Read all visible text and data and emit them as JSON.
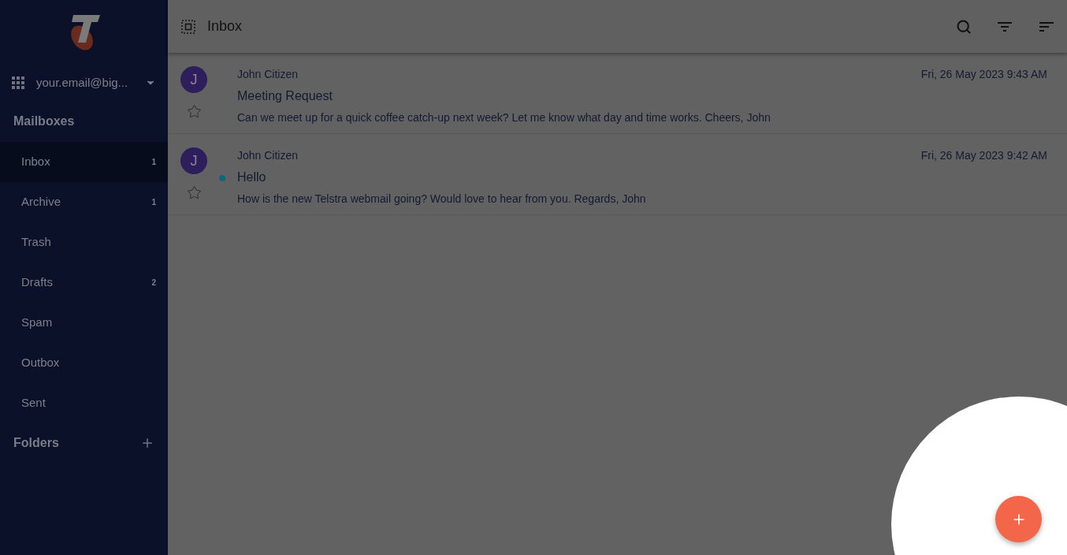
{
  "sidebar": {
    "account": "your.email@big...",
    "mailboxes_heading": "Mailboxes",
    "mailboxes": [
      {
        "label": "Inbox",
        "count": "1",
        "selected": true
      },
      {
        "label": "Archive",
        "count": "1",
        "selected": false
      },
      {
        "label": "Trash",
        "selected": false
      },
      {
        "label": "Drafts",
        "count": "2",
        "selected": false
      },
      {
        "label": "Spam",
        "selected": false
      },
      {
        "label": "Outbox",
        "selected": false
      },
      {
        "label": "Sent",
        "selected": false
      }
    ],
    "folders_heading": "Folders"
  },
  "header": {
    "title": "Inbox"
  },
  "messages": [
    {
      "avatar": "J",
      "sender": "John Citizen",
      "subject": "Meeting Request",
      "preview": "Can we meet up for a quick coffee catch-up next week? Let me know what day and time works. Cheers, John",
      "date": "Fri, 26 May 2023 9:43 AM",
      "unread": false,
      "starred": false
    },
    {
      "avatar": "J",
      "sender": "John Citizen",
      "subject": "Hello",
      "preview": "How is the new Telstra webmail going? Would love to hear from you. Regards, John",
      "date": "Fri, 26 May 2023 9:42 AM",
      "unread": true,
      "starred": false
    }
  ]
}
